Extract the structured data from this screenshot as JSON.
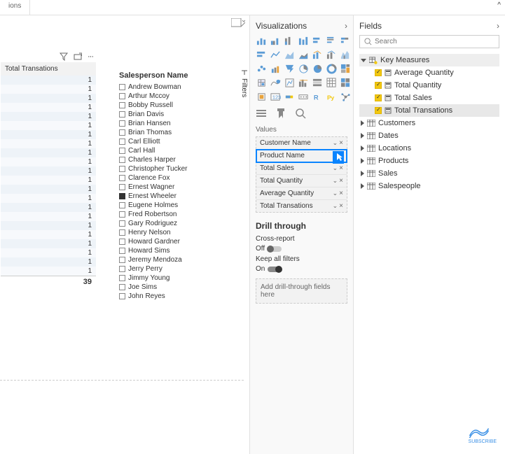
{
  "top": {
    "tab": "ions"
  },
  "canvas": {
    "visual1_header": "Total Transations",
    "visual1_rows": [
      "1",
      "1",
      "1",
      "1",
      "1",
      "1",
      "1",
      "1",
      "1",
      "1",
      "1",
      "1",
      "1",
      "1",
      "1",
      "1",
      "1",
      "1",
      "1",
      "1",
      "1",
      "1"
    ],
    "visual1_total": "39",
    "filter_title": "Salesperson Name",
    "filter_items": [
      {
        "label": "Andrew Bowman",
        "checked": false
      },
      {
        "label": "Arthur Mccoy",
        "checked": false
      },
      {
        "label": "Bobby Russell",
        "checked": false
      },
      {
        "label": "Brian Davis",
        "checked": false
      },
      {
        "label": "Brian Hansen",
        "checked": false
      },
      {
        "label": "Brian Thomas",
        "checked": false
      },
      {
        "label": "Carl Elliott",
        "checked": false
      },
      {
        "label": "Carl Hall",
        "checked": false
      },
      {
        "label": "Charles Harper",
        "checked": false
      },
      {
        "label": "Christopher Tucker",
        "checked": false
      },
      {
        "label": "Clarence Fox",
        "checked": false
      },
      {
        "label": "Ernest Wagner",
        "checked": false
      },
      {
        "label": "Ernest Wheeler",
        "checked": true
      },
      {
        "label": "Eugene Holmes",
        "checked": false
      },
      {
        "label": "Fred Robertson",
        "checked": false
      },
      {
        "label": "Gary Rodriguez",
        "checked": false
      },
      {
        "label": "Henry Nelson",
        "checked": false
      },
      {
        "label": "Howard Gardner",
        "checked": false
      },
      {
        "label": "Howard Sims",
        "checked": false
      },
      {
        "label": "Jeremy Mendoza",
        "checked": false
      },
      {
        "label": "Jerry Perry",
        "checked": false
      },
      {
        "label": "Jimmy Young",
        "checked": false
      },
      {
        "label": "Joe Sims",
        "checked": false
      },
      {
        "label": "John Reyes",
        "checked": false
      }
    ],
    "filters_label": "Filters"
  },
  "viz": {
    "title": "Visualizations",
    "values_label": "Values",
    "values": [
      "Customer Name",
      "Product Name",
      "Total Sales",
      "Total Quantity",
      "Average Quantity",
      "Total Transations"
    ],
    "highlight_index": 1,
    "drill_title": "Drill through",
    "cross_report_label": "Cross-report",
    "cross_report_state": "Off",
    "keep_filters_label": "Keep all filters",
    "keep_filters_state": "On",
    "drop_text": "Add drill-through fields here"
  },
  "fields": {
    "title": "Fields",
    "search_placeholder": "Search",
    "groups": [
      {
        "name": "Key Measures",
        "expanded": true,
        "items": [
          {
            "label": "Average Quantity",
            "checked": true
          },
          {
            "label": "Total Quantity",
            "checked": true
          },
          {
            "label": "Total Sales",
            "checked": true
          },
          {
            "label": "Total Transations",
            "checked": true,
            "selected": true
          }
        ]
      },
      {
        "name": "Customers",
        "expanded": false
      },
      {
        "name": "Dates",
        "expanded": false
      },
      {
        "name": "Locations",
        "expanded": false
      },
      {
        "name": "Products",
        "expanded": false
      },
      {
        "name": "Sales",
        "expanded": false
      },
      {
        "name": "Salespeople",
        "expanded": false
      }
    ]
  },
  "subscribe": "SUBSCRIBE"
}
